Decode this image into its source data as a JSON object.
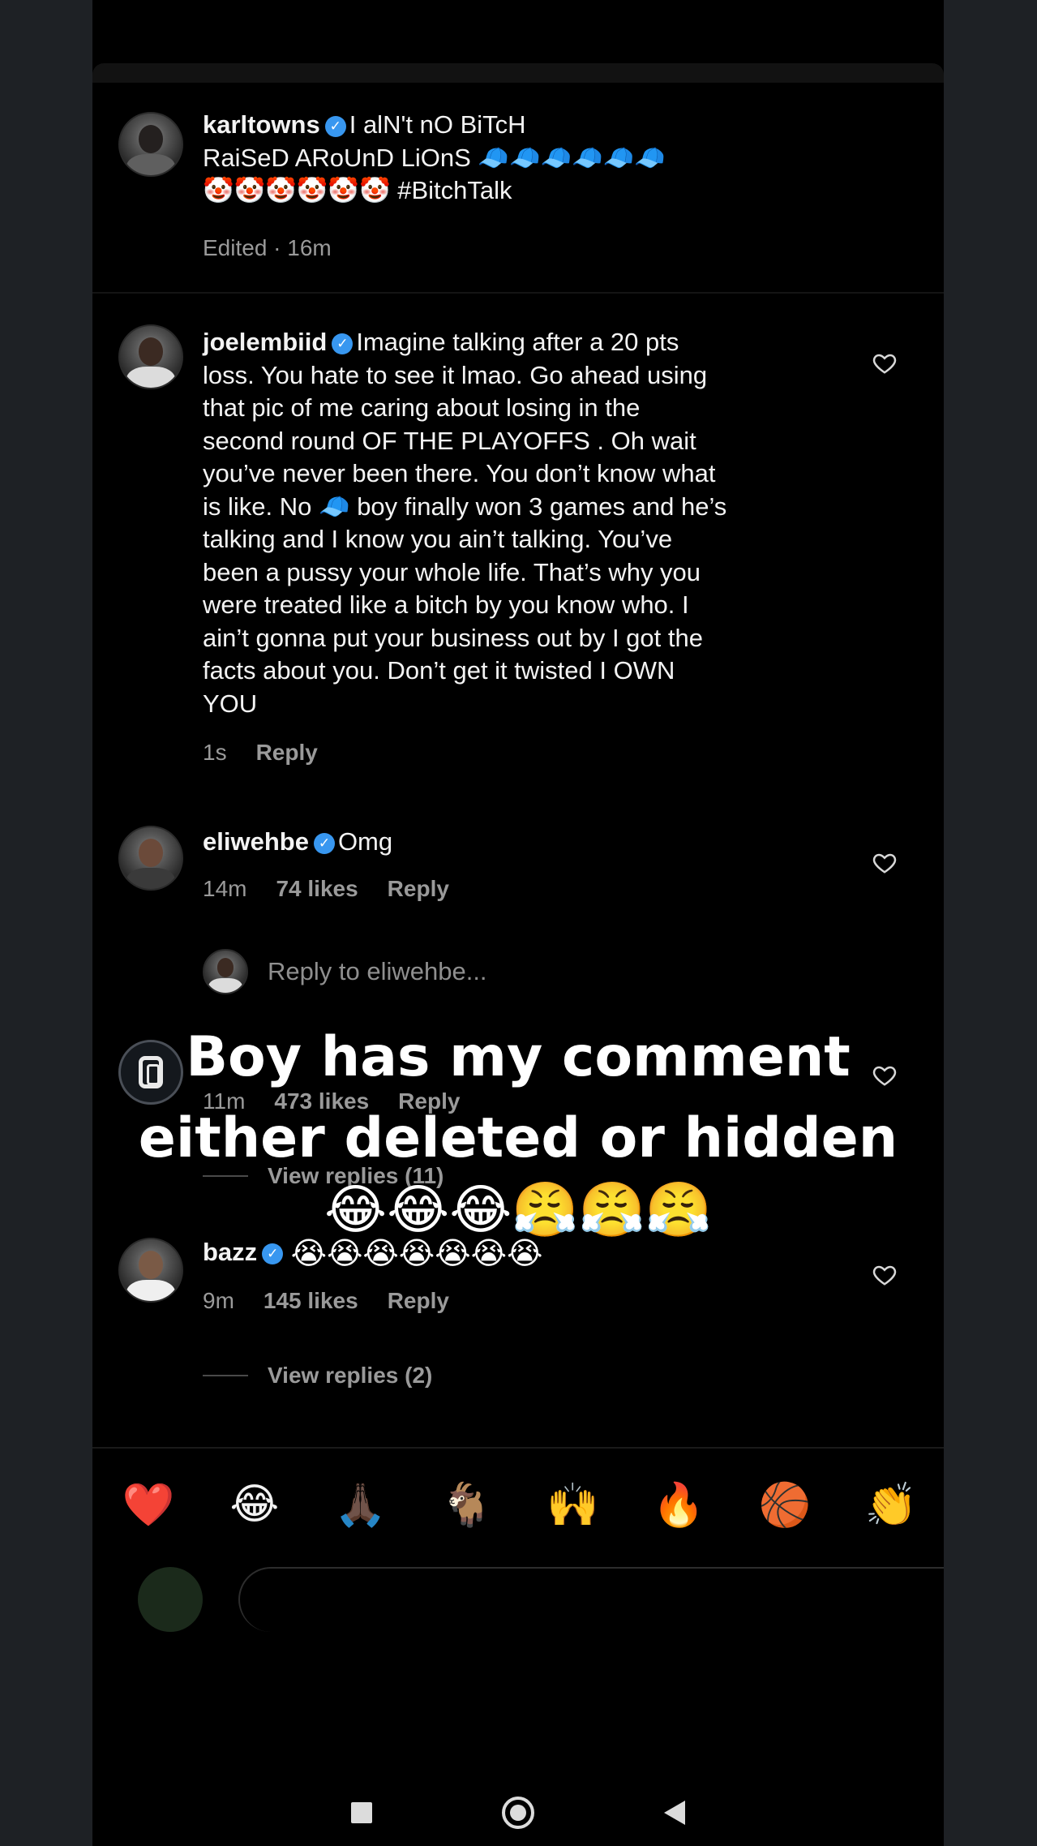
{
  "post": {
    "username": "karltowns",
    "caption_line1": "I alN't nO BiTcH",
    "caption_line2": "RaiSeD ARoUnD LiOnS 🧢🧢🧢🧢🧢🧢",
    "caption_line3": "🤡🤡🤡🤡🤡🤡 #BitchTalk",
    "meta": "Edited · 16m"
  },
  "comments": [
    {
      "username": "joelembiid",
      "lines": [
        "Imagine talking after a 20 pts",
        "loss. You hate to see it lmao. Go ahead using",
        "that pic of me caring about losing in the",
        "second round OF THE PLAYOFFS . Oh wait",
        "you’ve never been there. You don’t know what",
        "is like. No 🧢 boy finally won 3 games and he’s",
        "talking and I know you ain’t talking. You’ve",
        "been a pussy your whole life. That’s why you",
        "were treated like a bitch by you know who. I",
        "ain’t gonna put your business out by I got the",
        "facts about you. Don’t get it twisted I OWN",
        "YOU"
      ],
      "time": "1s",
      "reply": "Reply"
    },
    {
      "username": "eliwehbe",
      "text": "Omg",
      "time": "14m",
      "likes": "74 likes",
      "reply": "Reply"
    },
    {
      "username": "",
      "time": "11m",
      "likes": "473 likes",
      "reply": "Reply",
      "view_replies": "View replies (11)"
    },
    {
      "username": "bazz",
      "time": "9m",
      "likes": "145 likes",
      "reply": "Reply",
      "view_replies": "View replies (2)"
    }
  ],
  "reply_prompt": "Reply to eliwehbe...",
  "overlay": {
    "line1": "Boy has my comment",
    "line2": "either deleted or hidden",
    "emojis": "😂😂😂😤😤😤",
    "emojis_sub": "😭😭😭😭😭😭😭"
  },
  "quick_reactions": [
    "❤️",
    "😂",
    "🙏🏿",
    "🐐",
    "🙌",
    "🔥",
    "🏀",
    "👏"
  ],
  "icons": {
    "heart": "heart-icon",
    "verified": "verified-badge-icon",
    "nav_recent": "recent-apps-icon",
    "nav_home": "home-icon",
    "nav_back": "back-icon"
  },
  "colors": {
    "verified": "#3897f0",
    "background": "#000000",
    "muted_text": "#9a9a9a"
  }
}
